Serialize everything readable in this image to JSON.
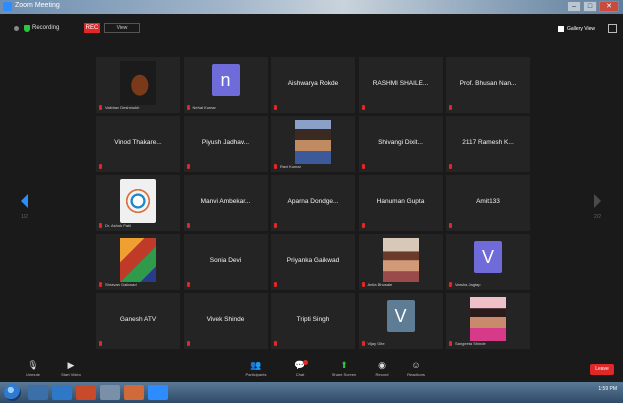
{
  "window": {
    "title": "Zoom Meeting"
  },
  "topbar": {
    "rec_label": "Recording",
    "rec_badge": "REC",
    "view_label": "View",
    "gallery_label": "Gallery View"
  },
  "participants": [
    {
      "name": "",
      "caption": "Vaibhav Deshmukh",
      "type": "photo",
      "photo": "ph-guitar"
    },
    {
      "name": "",
      "caption": "Nehal Kumar",
      "type": "avatar",
      "letter": "n",
      "avatar_color": "purple"
    },
    {
      "name": "Aishwarya Rokde",
      "caption": "",
      "type": "name"
    },
    {
      "name": "RASHMI SHAILE...",
      "caption": "",
      "type": "name"
    },
    {
      "name": "Prof. Bhusan Nan...",
      "caption": "",
      "type": "name"
    },
    {
      "name": "Vinod Thakare...",
      "caption": "",
      "type": "name"
    },
    {
      "name": "Piyush Jadhav...",
      "caption": "",
      "type": "name"
    },
    {
      "name": "",
      "caption": "Ravi Kumar",
      "type": "photo",
      "photo": "ph-man"
    },
    {
      "name": "Shivangi Dixit...",
      "caption": "",
      "type": "name"
    },
    {
      "name": "2117 Ramesh K...",
      "caption": "",
      "type": "name"
    },
    {
      "name": "",
      "caption": "Dr. Ashok Patil",
      "type": "photo",
      "photo": "ph-logo"
    },
    {
      "name": "Manvi Ambekar...",
      "caption": "",
      "type": "name"
    },
    {
      "name": "Aparna Dondge...",
      "caption": "",
      "type": "name"
    },
    {
      "name": "Hanuman Gupta",
      "caption": "",
      "type": "name"
    },
    {
      "name": "Amit133",
      "caption": "",
      "type": "name"
    },
    {
      "name": "",
      "caption": "Shravan Gaikwad",
      "type": "photo",
      "photo": "ph-colorful"
    },
    {
      "name": "Sonia Devi",
      "caption": "",
      "type": "name"
    },
    {
      "name": "Priyanka Gaikwad",
      "caption": "",
      "type": "name"
    },
    {
      "name": "",
      "caption": "Anita Bhosale",
      "type": "photo",
      "photo": "ph-woman1"
    },
    {
      "name": "",
      "caption": "Varsha Jagtap",
      "type": "avatar",
      "letter": "V",
      "avatar_color": "purple"
    },
    {
      "name": "Ganesh ATV",
      "caption": "",
      "type": "name"
    },
    {
      "name": "Vivek Shinde",
      "caption": "",
      "type": "name"
    },
    {
      "name": "Tripti Singh",
      "caption": "",
      "type": "name"
    },
    {
      "name": "",
      "caption": "Vijay Gite",
      "type": "avatar",
      "letter": "V",
      "avatar_color": "slate"
    },
    {
      "name": "",
      "caption": "Sangeeta Shinde",
      "type": "photo",
      "photo": "ph-woman2"
    }
  ],
  "pagination": {
    "left": "1/2",
    "right": "2/2"
  },
  "controls": {
    "unmute": "Unmute",
    "start_video": "Start Video",
    "participants": "Participants",
    "participants_count": "25",
    "chat": "Chat",
    "share_screen": "Share Screen",
    "record": "Record",
    "reactions": "Reactions",
    "end": "Leave"
  },
  "taskbar": {
    "time": "1:59 PM"
  }
}
